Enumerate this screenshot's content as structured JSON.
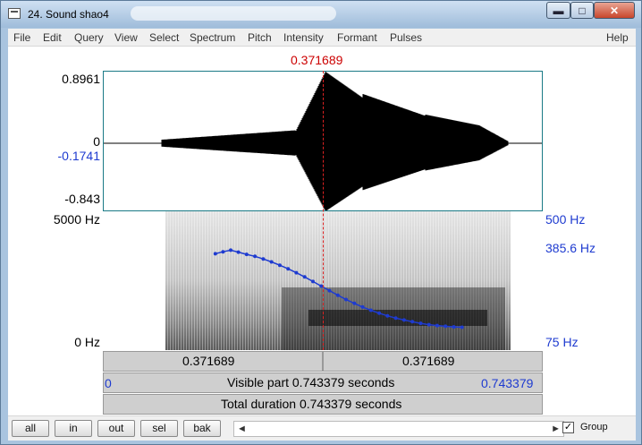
{
  "window": {
    "title": "24. Sound shao4",
    "controls": {
      "minimize": "▬",
      "maximize": "□",
      "close": "✕"
    }
  },
  "menu": [
    "File",
    "Edit",
    "Query",
    "View",
    "Select",
    "Spectrum",
    "Pitch",
    "Intensity",
    "Formant",
    "Pulses",
    "Help"
  ],
  "cursor": {
    "time_label": "0.371689"
  },
  "waveform": {
    "max_label": "0.8961",
    "zero_label": "0",
    "cursor_value_label": "-0.1741",
    "min_label": "-0.843"
  },
  "spectrogram": {
    "top_label": "5000 Hz",
    "bottom_label": "0 Hz",
    "pitch_top_label": "500 Hz",
    "pitch_cursor_label": "385.6 Hz",
    "pitch_bottom_label": "75 Hz"
  },
  "pitch_contour": {
    "time_range_s": [
      0,
      0.743379
    ],
    "pitch_range_hz": [
      75,
      500
    ],
    "points": [
      [
        0.19,
        370
      ],
      [
        0.203,
        376
      ],
      [
        0.216,
        381
      ],
      [
        0.229,
        375
      ],
      [
        0.243,
        368
      ],
      [
        0.257,
        362
      ],
      [
        0.271,
        354
      ],
      [
        0.285,
        345
      ],
      [
        0.299,
        335
      ],
      [
        0.313,
        324
      ],
      [
        0.327,
        312
      ],
      [
        0.341,
        299
      ],
      [
        0.355,
        285
      ],
      [
        0.369,
        271
      ],
      [
        0.383,
        257
      ],
      [
        0.397,
        243
      ],
      [
        0.411,
        230
      ],
      [
        0.425,
        218
      ],
      [
        0.439,
        207
      ],
      [
        0.453,
        197
      ],
      [
        0.467,
        188
      ],
      [
        0.481,
        180
      ],
      [
        0.495,
        173
      ],
      [
        0.509,
        167
      ],
      [
        0.523,
        162
      ],
      [
        0.537,
        157
      ],
      [
        0.551,
        153
      ],
      [
        0.565,
        150
      ],
      [
        0.579,
        148
      ],
      [
        0.593,
        146
      ],
      [
        0.607,
        145
      ]
    ]
  },
  "selection": {
    "left_label": "0.371689",
    "right_label": "0.371689"
  },
  "visible_part": {
    "start_label": "0",
    "text": "Visible part 0.743379 seconds",
    "end_label": "0.743379"
  },
  "total_duration": {
    "text": "Total duration 0.743379 seconds"
  },
  "bottom_buttons": [
    "all",
    "in",
    "out",
    "sel",
    "bak"
  ],
  "scroll": {
    "left_arrow": "◄",
    "right_arrow": "►"
  },
  "group": {
    "checked": true,
    "mark": "✓",
    "label": "Group"
  },
  "colors": {
    "cursor": "#cc0000",
    "pitch": "#1e3bd0",
    "wave_border": "#1a7a86"
  }
}
